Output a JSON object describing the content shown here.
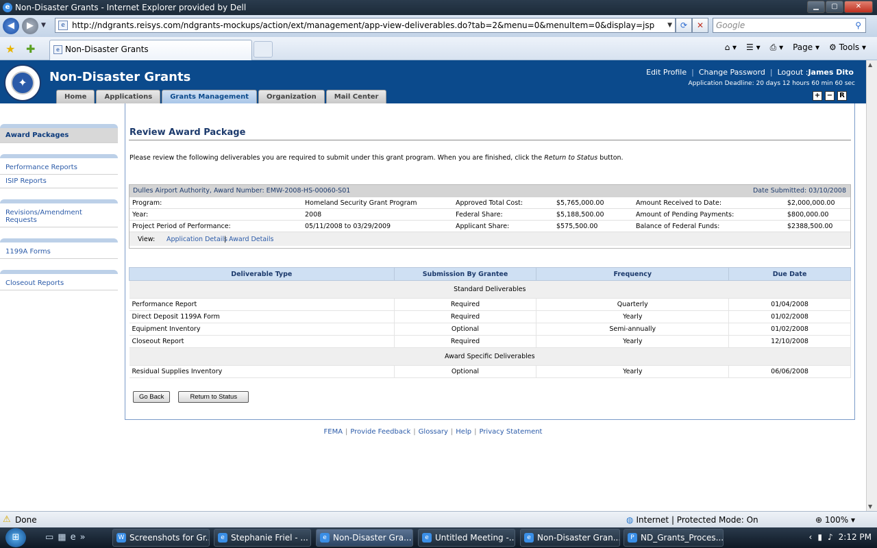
{
  "window": {
    "title": "Non-Disaster Grants - Internet Explorer provided by Dell"
  },
  "browser": {
    "url": "http://ndgrants.reisys.com/ndgrants-mockups/action/ext/management/app-view-deliverables.do?tab=2&menu=0&menuItem=0&display=jsp",
    "search_placeholder": "Google",
    "tab_title": "Non-Disaster Grants",
    "cmd_page": "Page",
    "cmd_tools": "Tools"
  },
  "header": {
    "site_title": "Non-Disaster Grants",
    "edit_profile": "Edit Profile",
    "change_password": "Change Password",
    "logout_prefix": "Logout :",
    "user_name": "James Dito",
    "deadline": "Application Deadline: 20 days 12 hours 60 min 60 sec",
    "tabs": [
      {
        "label": "Home"
      },
      {
        "label": "Applications"
      },
      {
        "label": "Grants Management"
      },
      {
        "label": "Organization"
      },
      {
        "label": "Mail Center"
      }
    ],
    "resize": [
      "+",
      "−",
      "R"
    ]
  },
  "sidebar": {
    "groups": [
      {
        "items": [
          "Award Packages"
        ]
      },
      {
        "items": [
          "Performance Reports",
          "ISIP Reports"
        ]
      },
      {
        "items": [
          "Revisions/Amendment Requests"
        ]
      },
      {
        "items": [
          "1199A Forms"
        ]
      },
      {
        "items": [
          "Closeout Reports"
        ]
      }
    ]
  },
  "main": {
    "heading": "Review Award Package",
    "intro_before": "Please review the following deliverables you are required to submit under this grant program. When you are finished, click the ",
    "intro_em": "Return to Status",
    "intro_after": " button.",
    "award": {
      "header": "Dulles Airport Authority, Award Number: EMW-2008-HS-00060-S01",
      "date_submitted": "Date Submitted: 03/10/2008",
      "rows": [
        [
          "Program:",
          "Homeland Security Grant Program",
          "Approved Total Cost:",
          "$5,765,000.00",
          "Amount Received to Date:",
          "$2,000,000.00"
        ],
        [
          "Year:",
          "2008",
          "Federal Share:",
          "$5,188,500.00",
          "Amount of Pending Payments:",
          "$800,000.00"
        ],
        [
          "Project Period of Performance:",
          "05/11/2008 to 03/29/2009",
          "Applicant Share:",
          "$575,500.00",
          "Balance of Federal Funds:",
          "$2388,500.00"
        ]
      ],
      "view_label": "View:",
      "view_link_1": "Application Details",
      "view_sep": "|",
      "view_link_2": "Award Details"
    },
    "deliverables": {
      "columns": [
        "Deliverable Type",
        "Submission By Grantee",
        "Frequency",
        "Due Date"
      ],
      "groups": [
        {
          "name": "Standard Deliverables",
          "rows": [
            [
              "Performance Report",
              "Required",
              "Quarterly",
              "01/04/2008"
            ],
            [
              "Direct Deposit 1199A Form",
              "Required",
              "Yearly",
              "01/02/2008"
            ],
            [
              "Equipment Inventory",
              "Optional",
              "Semi-annually",
              "01/02/2008"
            ],
            [
              "Closeout Report",
              "Required",
              "Yearly",
              "12/10/2008"
            ]
          ]
        },
        {
          "name": "Award Specific Deliverables",
          "rows": [
            [
              "Residual Supplies Inventory",
              "Optional",
              "Yearly",
              "06/06/2008"
            ]
          ]
        }
      ]
    },
    "go_back": "Go Back",
    "return_status": "Return to Status"
  },
  "footer": {
    "links": [
      "FEMA",
      "Provide Feedback",
      "Glossary",
      "Help",
      "Privacy Statement"
    ]
  },
  "status": {
    "done": "Done",
    "zone": "Internet | Protected Mode: On",
    "zoom": "100%"
  },
  "taskbar": {
    "items": [
      "Screenshots for Gr...",
      "Stephanie Friel - ...",
      "Non-Disaster Gra...",
      "Untitled Meeting -...",
      "Non-Disaster Gran...",
      "ND_Grants_Proces..."
    ],
    "time": "2:12 PM"
  }
}
